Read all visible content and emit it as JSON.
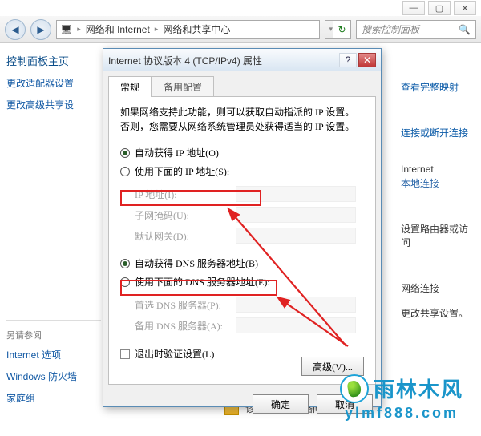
{
  "window": {
    "minimize": "—",
    "maximize": "▢",
    "close": "✕"
  },
  "nav": {
    "back": "◀",
    "forward": "▶",
    "crumb_icon": "🖥",
    "crumbs": [
      "网络和 Internet",
      "网络和共享中心"
    ],
    "sep": "▸",
    "refresh": "↻",
    "search_icon": "🔍",
    "search_placeholder": "搜索控制面板"
  },
  "sidebar": {
    "heading": "控制面板主页",
    "link_adapter": "更改适配器设置",
    "link_advshare": "更改高级共享设",
    "see_also": "另请参阅",
    "inet_opts": "Internet 选项",
    "firewall": "Windows 防火墙",
    "homegroup": "家庭组"
  },
  "right": {
    "full_map": "查看完整映射",
    "conn_disconn": "连接或断开连接",
    "internet": "Internet",
    "local_conn": "本地连接",
    "router_q": "设置路由器或访问",
    "net_conn": "网络连接",
    "change_share": "更改共享设置。",
    "diag": "诊断并修复网络问题，"
  },
  "dialog": {
    "title": "Internet 协议版本 4 (TCP/IPv4) 属性",
    "help": "?",
    "close": "✕",
    "tab_general": "常规",
    "tab_alt": "备用配置",
    "intro": "如果网络支持此功能，则可以获取自动指派的 IP 设置。否则，您需要从网络系统管理员处获得适当的 IP 设置。",
    "opt_autoip": "自动获得 IP 地址(O)",
    "opt_manualip": "使用下面的 IP 地址(S):",
    "lbl_ip": "IP 地址(I):",
    "lbl_mask": "子网掩码(U):",
    "lbl_gateway": "默认网关(D):",
    "opt_autodns": "自动获得 DNS 服务器地址(B)",
    "opt_manualdns": "使用下面的 DNS 服务器地址(E):",
    "lbl_dns1": "首选 DNS 服务器(P):",
    "lbl_dns2": "备用 DNS 服务器(A):",
    "validate_exit": "退出时验证设置(L)",
    "advanced": "高级(V)...",
    "ok": "确定",
    "cancel": "取消"
  },
  "banner": {
    "name": "雨林木风",
    "url": "ylmf888.com"
  }
}
